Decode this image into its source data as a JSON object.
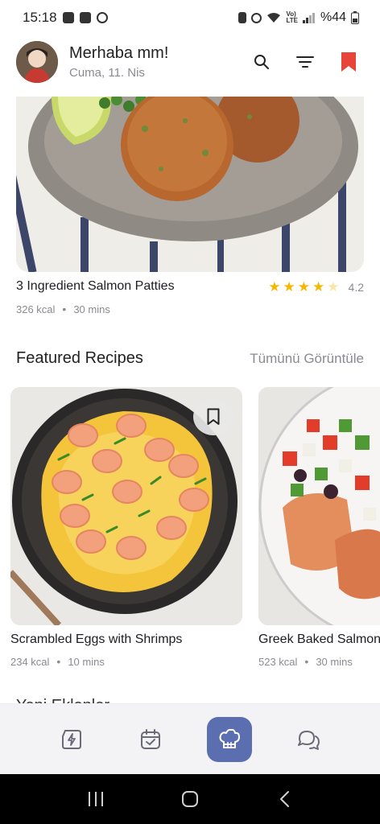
{
  "status_bar": {
    "time": "15:18",
    "battery": "%44"
  },
  "header": {
    "greeting": "Merhaba mm!",
    "date": "Cuma, 11. Nis",
    "avatar_icon": "user-avatar"
  },
  "top_recipe": {
    "title": "3 Ingredient Salmon Patties",
    "rating": "4.2",
    "rating_value": 4.2,
    "calories": "326 kcal",
    "time": "30 mins"
  },
  "featured": {
    "title": "Featured Recipes",
    "see_all": "Tümünü Görüntüle",
    "cards": [
      {
        "title": "Scrambled Eggs with Shrimps",
        "calories": "234 kcal",
        "time": "10 mins"
      },
      {
        "title": "Greek Baked Salmon",
        "calories": "523 kcal",
        "time": "30 mins"
      }
    ]
  },
  "next_section_partial": "Yeni Eklenler",
  "bottom_nav": {
    "items": [
      "bolt-icon",
      "calendar-check-icon",
      "chef-hat-icon",
      "chat-icon"
    ],
    "active_index": 2
  },
  "colors": {
    "accent": "#5b6eb0",
    "bookmark_red": "#e8443a",
    "star": "#f5b800"
  }
}
